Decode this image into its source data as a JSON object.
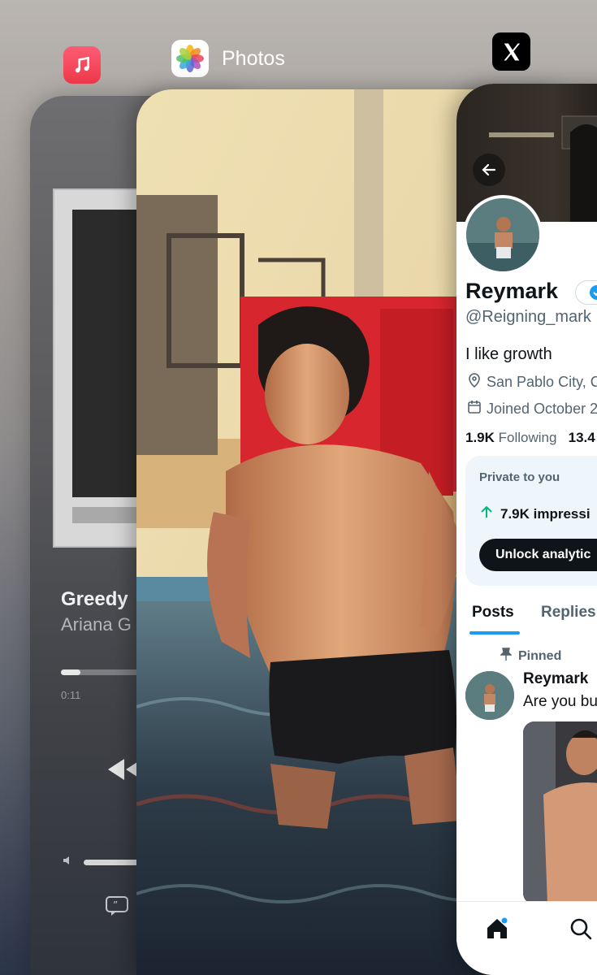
{
  "app_switcher": {
    "music_app": {
      "icon": "music-icon",
      "color": "#f2394b"
    },
    "photos_app": {
      "label": "Photos",
      "icon": "photos-icon"
    },
    "x_app": {
      "icon": "x-logo-icon"
    }
  },
  "music": {
    "song_title": "Greedy",
    "artist": "Ariana G",
    "elapsed": "0:11",
    "progress": 0.12
  },
  "x_profile": {
    "name": "Reymark",
    "handle": "@Reigning_mark",
    "bio": "I like growth",
    "location": "San Pablo City, C",
    "joined": "Joined October 2",
    "following_count": "1.9K",
    "following_label": "Following",
    "followers_count": "13.4",
    "private_title": "Private to you",
    "impressions": "7.9K impressi",
    "unlock_label": "Unlock analytic",
    "tabs": [
      "Posts",
      "Replies"
    ],
    "pinned_label": "Pinned",
    "post_author": "Reymark",
    "post_text": "Are you bu",
    "accent": "#1d9bf0"
  }
}
